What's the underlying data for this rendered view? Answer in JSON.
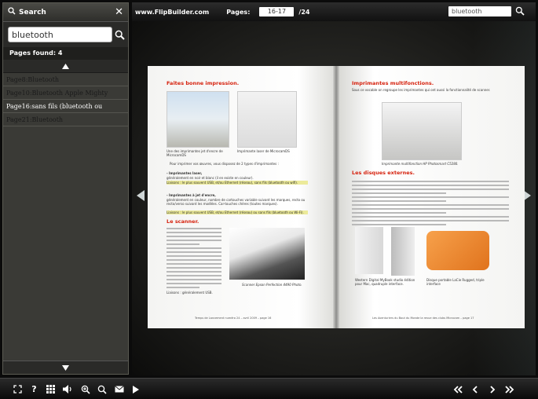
{
  "sidebar": {
    "title": "Search",
    "search_value": "bluetooth",
    "found_label": "Pages found: 4",
    "results": [
      {
        "label": "Page8:Bluetooth"
      },
      {
        "label": "Page10:Bluetooth Apple Mighty"
      },
      {
        "label": "Page16:sans fils (bluetooth ou"
      },
      {
        "label": "Page21:Bluetooth"
      }
    ]
  },
  "topbar": {
    "brand": "www.FlipBuilder.com",
    "pages_label": "Pages:",
    "current_pages": "16-17",
    "total_pages": "/24",
    "search_value": "bluetooth"
  },
  "book": {
    "left": {
      "heading1": "Faites bonne impression.",
      "caption1": "Une des imprimantes jet d'encre de MicrocamDS",
      "caption2": "Imprimante laser de MicrocamDS",
      "intro": "Pour imprimer vos œuvres, vous disposez de 2 types d'imprimantes :",
      "bullet1_title": "- Imprimantes laser,",
      "bullet1_text": "généralement en noir et blanc (il en existe en couleur).",
      "bullet1_link": "Liaisons : le plus souvent USB, et/ou Ethernet (réseau), sans fils (bluetooth ou wifi).",
      "bullet2_title": "- Imprimantes à jet d'encre,",
      "bullet2_text": "généralement en couleur, nombre de cartouches variable suivant les marques, recto ou recto/verso suivant les modèles. Car-touches chères (toutes marques).",
      "bullet2_link": "Liaisons : le plus souvent USB, et/ou Ethernet (réseau) ou sans fils (bluetooth ou Wi-Fi).",
      "heading2": "Le scanner.",
      "scanner_caption": "Scanner Epson Perfection 4490 Photo.",
      "liaisons": "Liaisons : généralement USB.",
      "footer": "Temps de Lancement numéro 24 – avril 2009 – page 16"
    },
    "right": {
      "heading1": "Imprimantes multifonctions.",
      "intro": "Sous ce vocable on regroupe les imprimantes qui ont aussi la fonctionnalité de scanner.",
      "mfp_caption": "Imprimante multifonction HP Photosmart C5280.",
      "heading2": "Les disques externes.",
      "drive_caption1": "Western Digital MyBook studio édition pour Mac, quadruple interface.",
      "drive_caption2": "Disque portable LaCie Rugged, triple interface",
      "footer": "Les Aventuriers du Bout du Monde la revue des clubs Microcam – page 17"
    }
  },
  "colors": {
    "heading_red": "#d6230f",
    "highlight_yellow": "#e6e07a"
  }
}
